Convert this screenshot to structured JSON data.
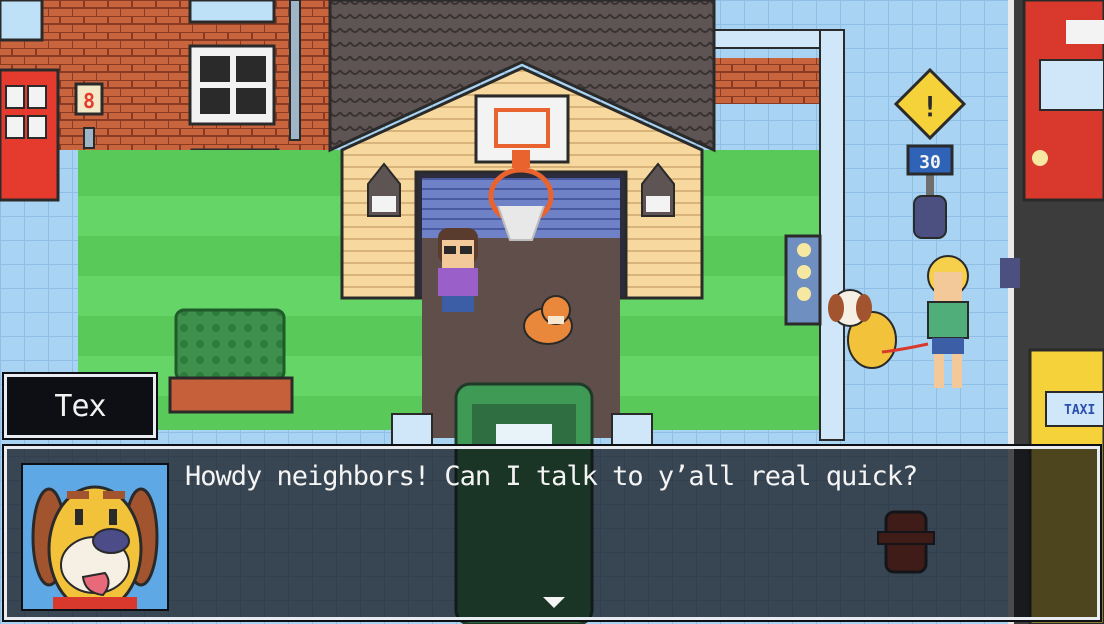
{
  "speaker": {
    "name": "Tex",
    "portrait": "dog-portrait-icon"
  },
  "dialog": {
    "text": "Howdy neighbors! Can I talk to y’all real quick?",
    "advance_icon": "down-triangle-icon"
  },
  "scene": {
    "house_number": "8",
    "speed_sign": "30",
    "warning_sign": "!",
    "taxi_label": "TAXI"
  },
  "colors": {
    "grass": "#59c95a",
    "sidewalk": "#a9d3f2",
    "road": "#3b3b3b",
    "brick": "#c5603a",
    "roof": "#5a4f4f",
    "dialog_border": "#e9ecf0",
    "portrait_bg": "#5fa8e6",
    "dog": "#f2c33a"
  }
}
